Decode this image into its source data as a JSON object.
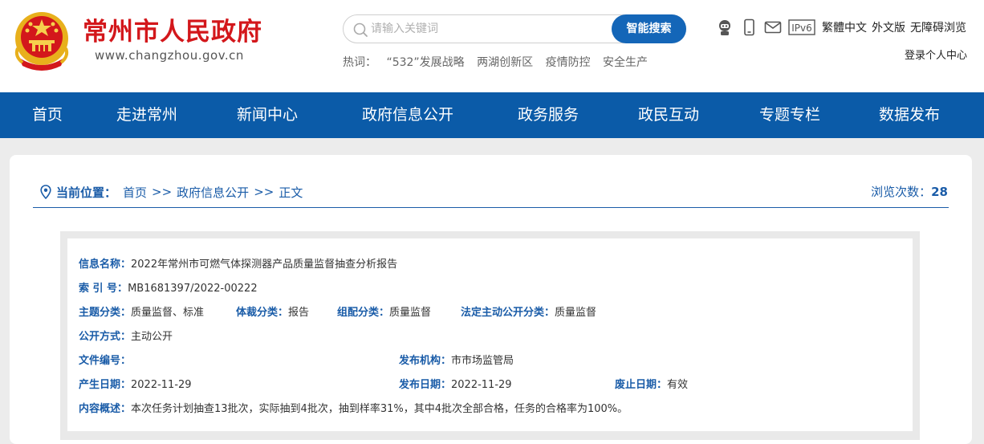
{
  "header": {
    "site_title": "常州市人民政府",
    "site_url": "www.changzhou.gov.cn",
    "search": {
      "placeholder": "请输入关键词",
      "button_label": "智能搜索"
    },
    "hot_words": {
      "label": "热词：",
      "items": [
        "“532”发展战略",
        "两湖创新区",
        "疫情防控",
        "安全生产"
      ]
    },
    "tools": {
      "icons": [
        "robot-icon",
        "mobile-icon",
        "mail-icon",
        "ipv6-icon"
      ],
      "ipv6_label": "IPv6",
      "traditional": "繁體中文",
      "foreign": "外文版",
      "accessible": "无障碍浏览"
    },
    "login": "登录个人中心"
  },
  "nav": {
    "items": [
      "首页",
      "走进常州",
      "新闻中心",
      "政府信息公开",
      "政务服务",
      "政民互动",
      "专题专栏",
      "数据发布"
    ]
  },
  "breadcrumb": {
    "label": "当前位置：",
    "items": [
      "首页",
      "政府信息公开",
      "正文"
    ],
    "separator": ">>"
  },
  "view_count": {
    "label": "浏览次数：",
    "value": "28"
  },
  "info": {
    "name_label": "信息名称：",
    "name_value": "2022年常州市可燃气体探测器产品质量监督抽查分析报告",
    "index_label": "索 引 号：",
    "index_value": "MB1681397/2022-00222",
    "topic_label": "主题分类：",
    "topic_value": "质量监督、标准",
    "genre_label": "体裁分类：",
    "genre_value": "报告",
    "org_class_label": "组配分类：",
    "org_class_value": "质量监督",
    "legal_label": "法定主动公开分类：",
    "legal_value": "质量监督",
    "method_label": "公开方式：",
    "method_value": "主动公开",
    "doc_no_label": "文件编号：",
    "doc_no_value": "",
    "publisher_label": "发布机构：",
    "publisher_value": "市市场监管局",
    "created_label": "产生日期：",
    "created_value": "2022-11-29",
    "published_label": "发布日期：",
    "published_value": "2022-11-29",
    "abolished_label": "废止日期：",
    "abolished_value": "有效",
    "summary_label": "内容概述：",
    "summary_value": "本次任务计划抽查13批次，实际抽到4批次，抽到样率31%，其中4批次全部合格，任务的合格率为100%。"
  },
  "colors": {
    "brand_red": "#d3171b",
    "nav_blue": "#0b5ba8",
    "link_blue": "#1a5ca8",
    "button_blue": "#1466b8"
  }
}
